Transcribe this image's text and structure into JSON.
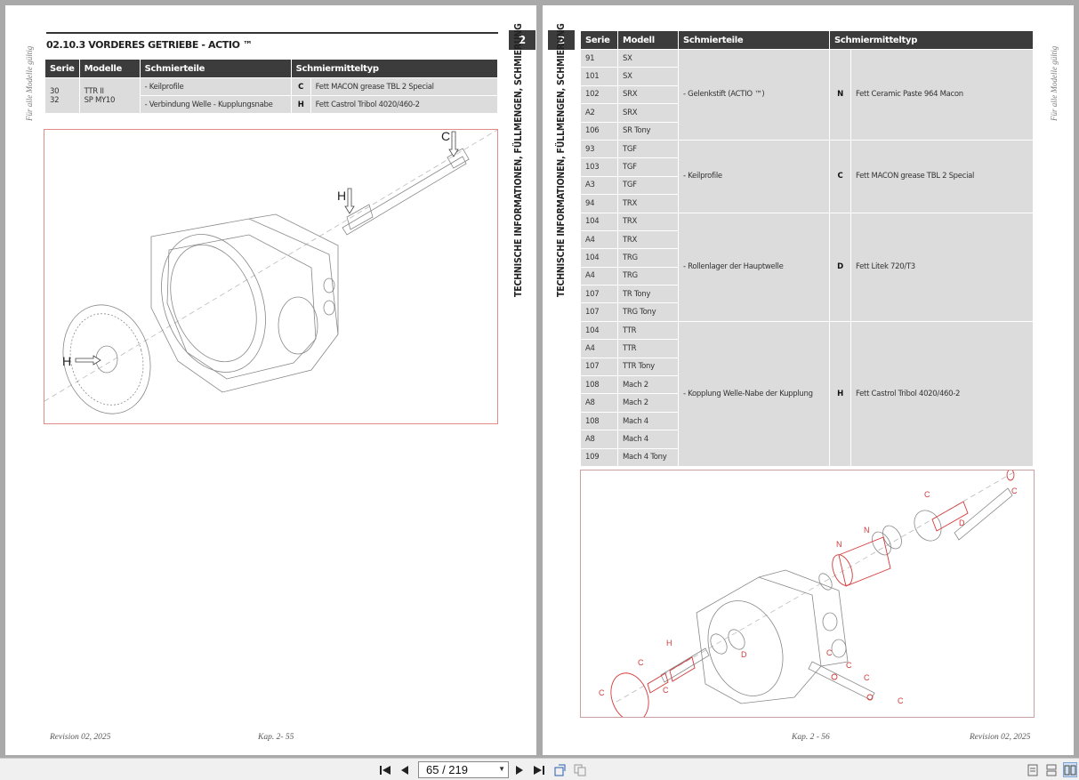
{
  "left_page": {
    "side_note": "Für alle Modelle gültig",
    "chapter_tab": "2",
    "vertical_title": "TECHNISCHE INFORMATIONEN, FÜLLMENGEN, SCHMIERUNG",
    "section_title": "02.10.3   VORDERES GETRIEBE - ACTIO ™",
    "table": {
      "headers": [
        "Serie",
        "Modelle",
        "Schmierteile",
        "Schmiermitteltyp"
      ],
      "serie": "30\n32",
      "modelle": "TTR II\nSP MY10",
      "rows": [
        {
          "part": "- Keilprofile",
          "code": "C",
          "type": "Fett MACON grease TBL 2 Special"
        },
        {
          "part": "- Verbindung Welle - Kupplungsnabe",
          "code": "H",
          "type": "Fett Castrol Tribol 4020/460-2"
        }
      ]
    },
    "figure_labels": {
      "c": "C",
      "h1": "H",
      "h2": "H"
    },
    "footer_left": "Revision 02, 2025",
    "footer_center": "Kap. 2- 55"
  },
  "right_page": {
    "side_note": "Für alle Modelle gültig",
    "chapter_tab": "2",
    "vertical_title": "TECHNISCHE INFORMATIONEN, FÜLLMENGEN, SCHMIERUNG",
    "table": {
      "headers": [
        "Serie",
        "Modell",
        "Schmierteile",
        "Schmiermitteltyp"
      ],
      "groups": [
        {
          "part": "- Gelenkstift (ACTIO ™)",
          "code": "N",
          "type": "Fett Ceramic Paste 964 Macon",
          "rows": [
            [
              "91",
              "SX"
            ],
            [
              "101",
              "SX"
            ],
            [
              "102",
              "SRX"
            ],
            [
              "A2",
              "SRX"
            ],
            [
              "106",
              "SR Tony"
            ]
          ]
        },
        {
          "part": "- Keilprofile",
          "code": "C",
          "type": "Fett MACON grease TBL 2 Special",
          "rows": [
            [
              "93",
              "TGF"
            ],
            [
              "103",
              "TGF"
            ],
            [
              "A3",
              "TGF"
            ],
            [
              "94",
              "TRX"
            ]
          ]
        },
        {
          "part": "- Rollenlager der Hauptwelle",
          "code": "D",
          "type": "Fett Litek 720/T3",
          "rows": [
            [
              "104",
              "TRX"
            ],
            [
              "A4",
              "TRX"
            ],
            [
              "104",
              "TRG"
            ],
            [
              "A4",
              "TRG"
            ],
            [
              "107",
              "TR Tony"
            ],
            [
              "107",
              "TRG Tony"
            ]
          ]
        },
        {
          "part": "- Kopplung Welle-Nabe der Kupplung",
          "code": "H",
          "type": "Fett Castrol Tribol 4020/460-2",
          "rows": [
            [
              "104",
              "TTR"
            ],
            [
              "A4",
              "TTR"
            ],
            [
              "107",
              "TTR Tony"
            ],
            [
              "108",
              "Mach 2"
            ],
            [
              "A8",
              "Mach 2"
            ],
            [
              "108",
              "Mach 4"
            ],
            [
              "A8",
              "Mach 4"
            ],
            [
              "109",
              "Mach 4 Tony"
            ]
          ]
        }
      ]
    },
    "figure_labels": {
      "c": "C",
      "n": "N",
      "d": "D",
      "h": "H"
    },
    "footer_center": "Kap. 2 - 56",
    "footer_right": "Revision 02, 2025"
  },
  "toolbar": {
    "page_indicator": "65 / 219",
    "icons": [
      "first-page-icon",
      "prev-page-icon",
      "next-page-icon",
      "last-page-icon",
      "rotate-icon",
      "copy-icon",
      "single-page-icon",
      "continuous-icon",
      "two-page-icon"
    ]
  }
}
